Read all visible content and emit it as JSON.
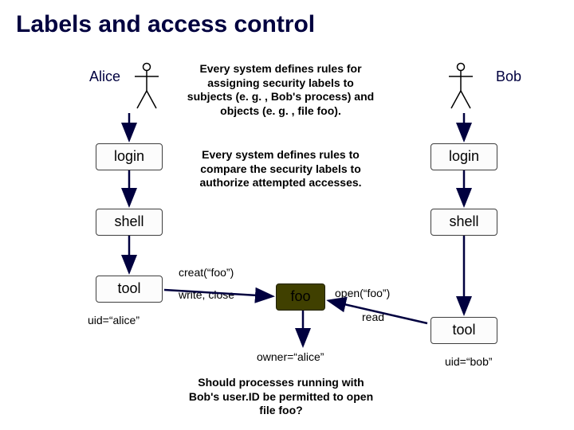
{
  "title": "Labels and access control",
  "users": {
    "alice": "Alice",
    "bob": "Bob"
  },
  "para1": "Every system defines rules for assigning security labels to subjects (e. g. , Bob's process) and objects (e. g. , file foo).",
  "para2": "Every system defines rules to compare the security labels to authorize attempted accesses.",
  "question": "Should processes running with Bob's user.ID be permitted to open file foo?",
  "boxes": {
    "login": "login",
    "shell": "shell",
    "tool": "tool",
    "foo": "foo"
  },
  "labels": {
    "uid_alice": "uid=“alice”",
    "uid_bob": "uid=“bob”",
    "owner_alice": "owner=“alice”",
    "creat": "creat(“foo”)",
    "write_close": "write, close",
    "open": "open(“foo”)",
    "read": "read"
  }
}
